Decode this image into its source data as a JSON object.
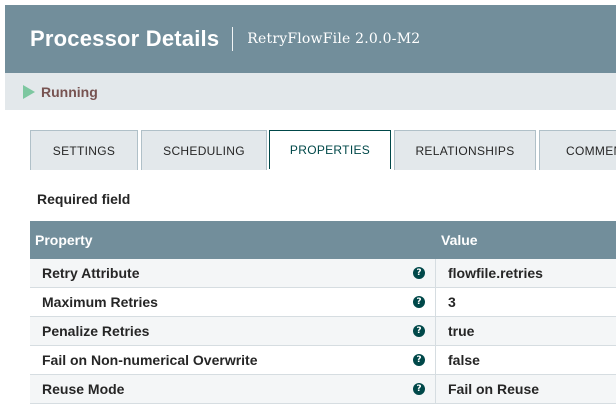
{
  "header": {
    "title": "Processor Details",
    "subtitle": "RetryFlowFile 2.0.0-M2"
  },
  "status": {
    "label": "Running",
    "icon": "play-icon",
    "icon_color": "#7dc7a0"
  },
  "tabs": [
    {
      "label": "SETTINGS",
      "active": false
    },
    {
      "label": "SCHEDULING",
      "active": false
    },
    {
      "label": "PROPERTIES",
      "active": true
    },
    {
      "label": "RELATIONSHIPS",
      "active": false
    },
    {
      "label": "COMMENTS",
      "active": false
    }
  ],
  "required_label": "Required field",
  "table": {
    "columns": [
      "Property",
      "Value"
    ],
    "rows": [
      {
        "property": "Retry Attribute",
        "value": "flowfile.retries"
      },
      {
        "property": "Maximum Retries",
        "value": "3"
      },
      {
        "property": "Penalize Retries",
        "value": "true"
      },
      {
        "property": "Fail on Non-numerical Overwrite",
        "value": "false"
      },
      {
        "property": "Reuse Mode",
        "value": "Fail on Reuse"
      }
    ]
  },
  "colors": {
    "header_bg": "#728e9b",
    "status_bg": "#e3e8eb",
    "status_text": "#775351",
    "accent": "#004849"
  }
}
